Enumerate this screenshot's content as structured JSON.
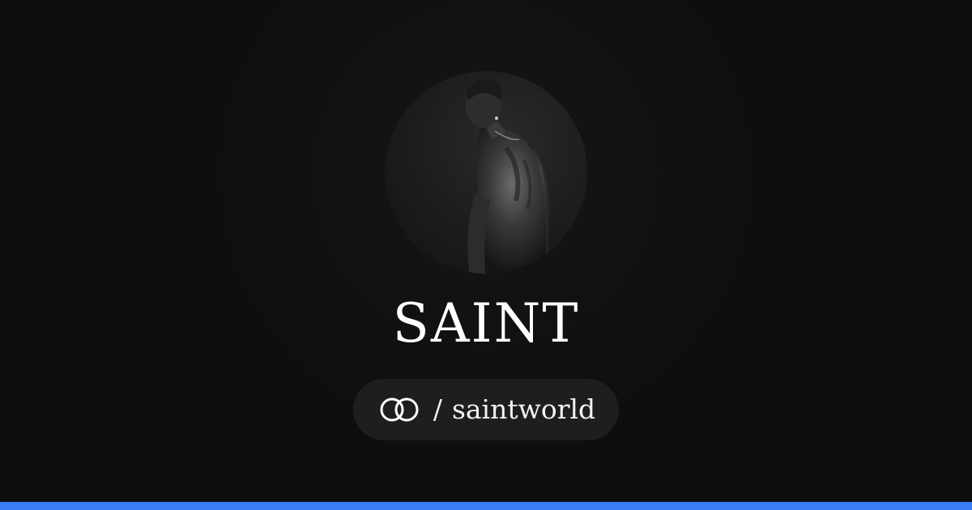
{
  "profile": {
    "name": "SAINT",
    "handle_separator": "/",
    "handle": "saintworld"
  },
  "icons": {
    "avatar": "profile-photo",
    "brand": "linked-rings-logo"
  },
  "colors": {
    "background": "#0d0d0e",
    "pill": "#1e1e1f",
    "text": "#ffffff",
    "accent": "#3b7bf6"
  }
}
